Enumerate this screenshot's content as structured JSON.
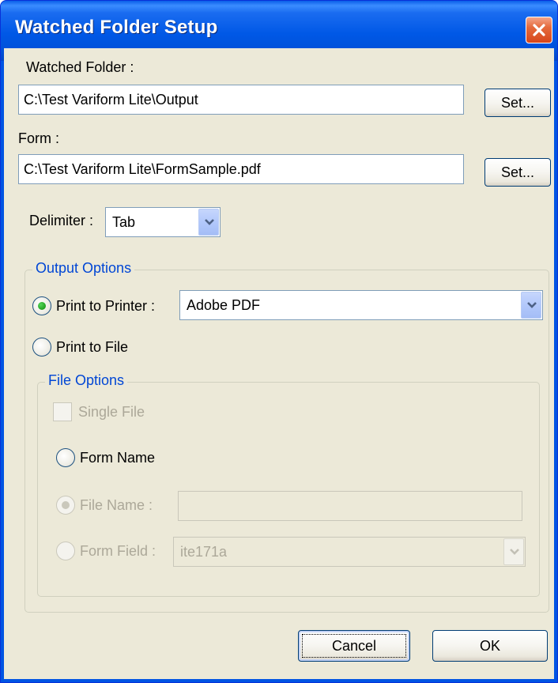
{
  "window": {
    "title": "Watched Folder Setup",
    "close_icon": "close-icon"
  },
  "watched_folder": {
    "label": "Watched Folder :",
    "value": "C:\\Test Variform Lite\\Output",
    "set_label": "Set..."
  },
  "form": {
    "label": "Form :",
    "value": "C:\\Test Variform Lite\\FormSample.pdf",
    "set_label": "Set..."
  },
  "delimiter": {
    "label": "Delimiter :",
    "value": "Tab"
  },
  "output_options": {
    "title": "Output Options",
    "print_to_printer": {
      "label": "Print to Printer :",
      "checked": true
    },
    "printer": {
      "value": "Adobe PDF"
    },
    "print_to_file": {
      "label": "Print to File",
      "checked": false
    }
  },
  "file_options": {
    "title": "File Options",
    "single_file": {
      "label": "Single File",
      "checked": false,
      "disabled": true
    },
    "form_name": {
      "label": "Form Name",
      "checked": false
    },
    "file_name": {
      "label": "File Name :",
      "checked": true,
      "disabled": true,
      "value": ""
    },
    "form_field": {
      "label": "Form Field :",
      "checked": false,
      "disabled": true,
      "value": "ite171a"
    }
  },
  "buttons": {
    "cancel": "Cancel",
    "ok": "OK"
  },
  "colors": {
    "titlebar": "#0054e3",
    "dialog_bg": "#ece9d8",
    "group_title": "#0046d5",
    "radio_check": "#21a121",
    "close": "#d7461b"
  }
}
